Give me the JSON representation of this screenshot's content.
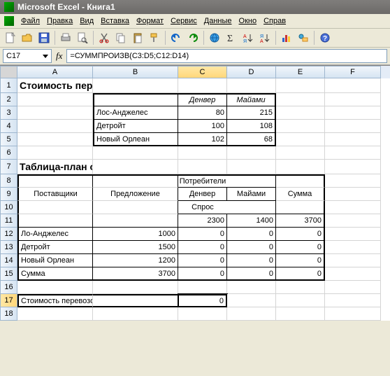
{
  "app": {
    "title": "Microsoft Excel - Книга1"
  },
  "menu": {
    "file": "Файл",
    "edit": "Правка",
    "view": "Вид",
    "insert": "Вставка",
    "format": "Формат",
    "tools": "Сервис",
    "data": "Данные",
    "window": "Окно",
    "help": "Справ"
  },
  "namebox": "C17",
  "formula": "=СУММПРОИЗВ(C3:D5;C12:D14)",
  "cols": {
    "A": "A",
    "B": "B",
    "C": "C",
    "D": "D",
    "E": "E",
    "F": "F"
  },
  "rows": {
    "r1": "1",
    "r2": "2",
    "r3": "3",
    "r4": "4",
    "r5": "5",
    "r6": "6",
    "r7": "7",
    "r8": "8",
    "r9": "9",
    "r10": "10",
    "r11": "11",
    "r12": "12",
    "r13": "13",
    "r14": "14",
    "r15": "15",
    "r16": "16",
    "r17": "17",
    "r18": "18"
  },
  "t1": {
    "title": "Стоимость перевозки одного автомобиля",
    "hC": "Денвер",
    "hD": "Майами",
    "r3B": "Лос-Анджелес",
    "r3C": "80",
    "r3D": "215",
    "r4B": "Детройт",
    "r4C": "100",
    "r4D": "108",
    "r5B": "Новый Орлеан",
    "r5C": "102",
    "r5D": "68"
  },
  "t2": {
    "title": "Таблица-план оптимального закрепления",
    "suppliers": "Поставщики",
    "offer": "Предложение",
    "consumers": "Потребители",
    "sum": "Сумма",
    "denver": "Денвер",
    "miami": "Майами",
    "demand": "Спрос",
    "d1": "2300",
    "d2": "1400",
    "dsum": "3700",
    "r12A": "Ло-Анджелес",
    "r12B": "1000",
    "r12C": "0",
    "r12D": "0",
    "r12E": "0",
    "r13A": "Детройт",
    "r13B": "1500",
    "r13C": "0",
    "r13D": "0",
    "r13E": "0",
    "r14A": "Новый Орлеан",
    "r14B": "1200",
    "r14C": "0",
    "r14D": "0",
    "r14E": "0",
    "r15A": "Сумма",
    "r15B": "3700",
    "r15C": "0",
    "r15D": "0",
    "r15E": "0"
  },
  "cost": {
    "label": "Стоимость перевозок, $",
    "value": "0"
  },
  "chart_data": [
    {
      "type": "table",
      "title": "Стоимость перевозки одного автомобиля",
      "columns": [
        "",
        "Денвер",
        "Майами"
      ],
      "rows": [
        [
          "Лос-Анджелес",
          80,
          215
        ],
        [
          "Детройт",
          100,
          108
        ],
        [
          "Новый Орлеан",
          102,
          68
        ]
      ]
    },
    {
      "type": "table",
      "title": "Таблица-план оптимального закрепления",
      "columns": [
        "Поставщики",
        "Предложение",
        "Денвер",
        "Майами",
        "Сумма"
      ],
      "demand": {
        "Денвер": 2300,
        "Майами": 1400,
        "Сумма": 3700
      },
      "rows": [
        [
          "Ло-Анджелес",
          1000,
          0,
          0,
          0
        ],
        [
          "Детройт",
          1500,
          0,
          0,
          0
        ],
        [
          "Новый Орлеан",
          1200,
          0,
          0,
          0
        ],
        [
          "Сумма",
          3700,
          0,
          0,
          0
        ]
      ],
      "cost": {
        "label": "Стоимость перевозок, $",
        "value": 0
      }
    }
  ]
}
